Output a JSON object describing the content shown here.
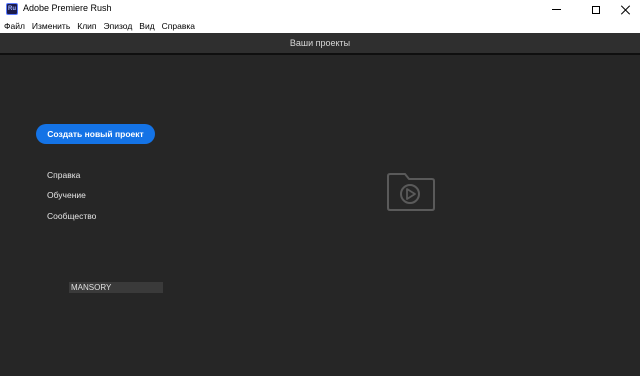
{
  "window": {
    "title": "Adobe Premiere Rush",
    "app_icon_text": "Ru"
  },
  "menu": {
    "items": [
      "Файл",
      "Изменить",
      "Клип",
      "Эпизод",
      "Вид",
      "Справка"
    ]
  },
  "header": {
    "title": "Ваши проекты"
  },
  "main": {
    "create_button": "Создать новый проект",
    "links": [
      "Справка",
      "Обучение",
      "Сообщество"
    ],
    "project_name": "MANSORY",
    "empty_state_icon": "folder-play-icon"
  },
  "colors": {
    "accent": "#1473e6",
    "background": "#262626",
    "header": "#2f2f2f"
  }
}
